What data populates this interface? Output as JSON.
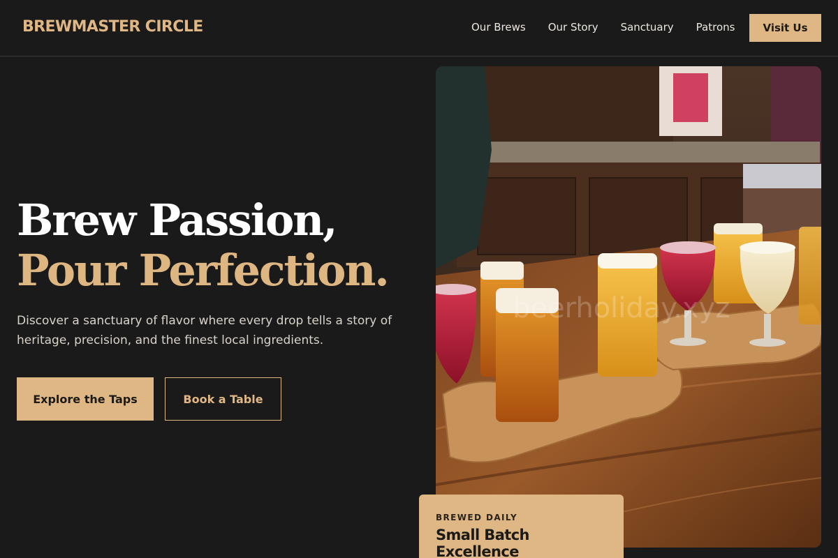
{
  "brand": {
    "name": "BREWMASTER CIRCLE"
  },
  "nav": {
    "items": [
      "Our Brews",
      "Our Story",
      "Sanctuary",
      "Patrons"
    ],
    "cta": "Visit Us"
  },
  "hero": {
    "title_line1": "Brew Passion,",
    "title_line2": "Pour Perfection.",
    "subtitle": "Discover a sanctuary of flavor where every drop tells a story of heritage, precision, and the finest local ingredients.",
    "primary_cta": "Explore the Taps",
    "secondary_cta": "Book a Table"
  },
  "photo": {
    "subject": "beer flight paddles with tasting glasses on a wooden bar",
    "watermark": "beerholiday.xyz"
  },
  "badge": {
    "eyebrow": "BREWED DAILY",
    "title": "Small Batch Excellence"
  },
  "colors": {
    "background": "#1a1a1a",
    "accent": "#dfb784",
    "text": "#ffffff"
  }
}
